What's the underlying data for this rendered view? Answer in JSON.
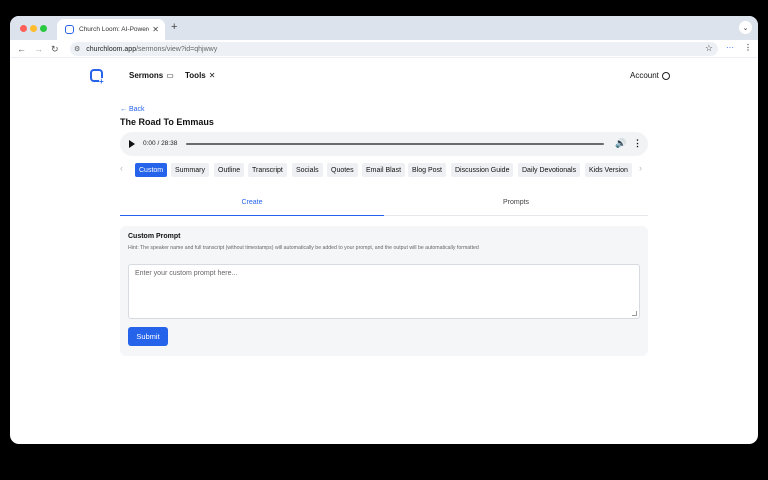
{
  "browser": {
    "tab_title": "Church Loom: AI-Powered Con",
    "tab_close": "✕",
    "new_tab": "+",
    "url_host": "churchloom.app",
    "url_path": "/sermons/view?id=qhjwwy",
    "tab_menu_icon": "chevron-down-icon"
  },
  "header": {
    "nav": [
      {
        "label": "Sermons",
        "icon": "podium-icon"
      },
      {
        "label": "Tools",
        "icon": "tools-icon"
      }
    ],
    "account_label": "Account"
  },
  "sermon": {
    "back_label": "← Back",
    "title": "The Road To Emmaus"
  },
  "audio": {
    "time": "0:00 / 28:38",
    "progress": 0
  },
  "content_tabs": [
    {
      "label": "Custom",
      "active": true
    },
    {
      "label": "Summary",
      "active": false
    },
    {
      "label": "Outline",
      "active": false
    },
    {
      "label": "Transcript",
      "active": false
    },
    {
      "label": "Socials",
      "active": false
    },
    {
      "label": "Quotes",
      "active": false
    },
    {
      "label": "Email Blast",
      "active": false
    },
    {
      "label": "Blog Post",
      "active": false
    },
    {
      "label": "Discussion Guide",
      "active": false
    },
    {
      "label": "Daily Devotionals",
      "active": false
    },
    {
      "label": "Kids Version",
      "active": false
    }
  ],
  "sub_tabs": [
    {
      "label": "Create",
      "selected": true
    },
    {
      "label": "Prompts",
      "selected": false
    }
  ],
  "custom_prompt": {
    "title": "Custom Prompt",
    "hint": "Hint: The speaker name and full transcript (without timestamps) will automatically be added to your prompt, and the output will be automatically formatted",
    "placeholder": "Enter your custom prompt here...",
    "submit_label": "Submit"
  },
  "colors": {
    "accent": "#2563eb"
  }
}
